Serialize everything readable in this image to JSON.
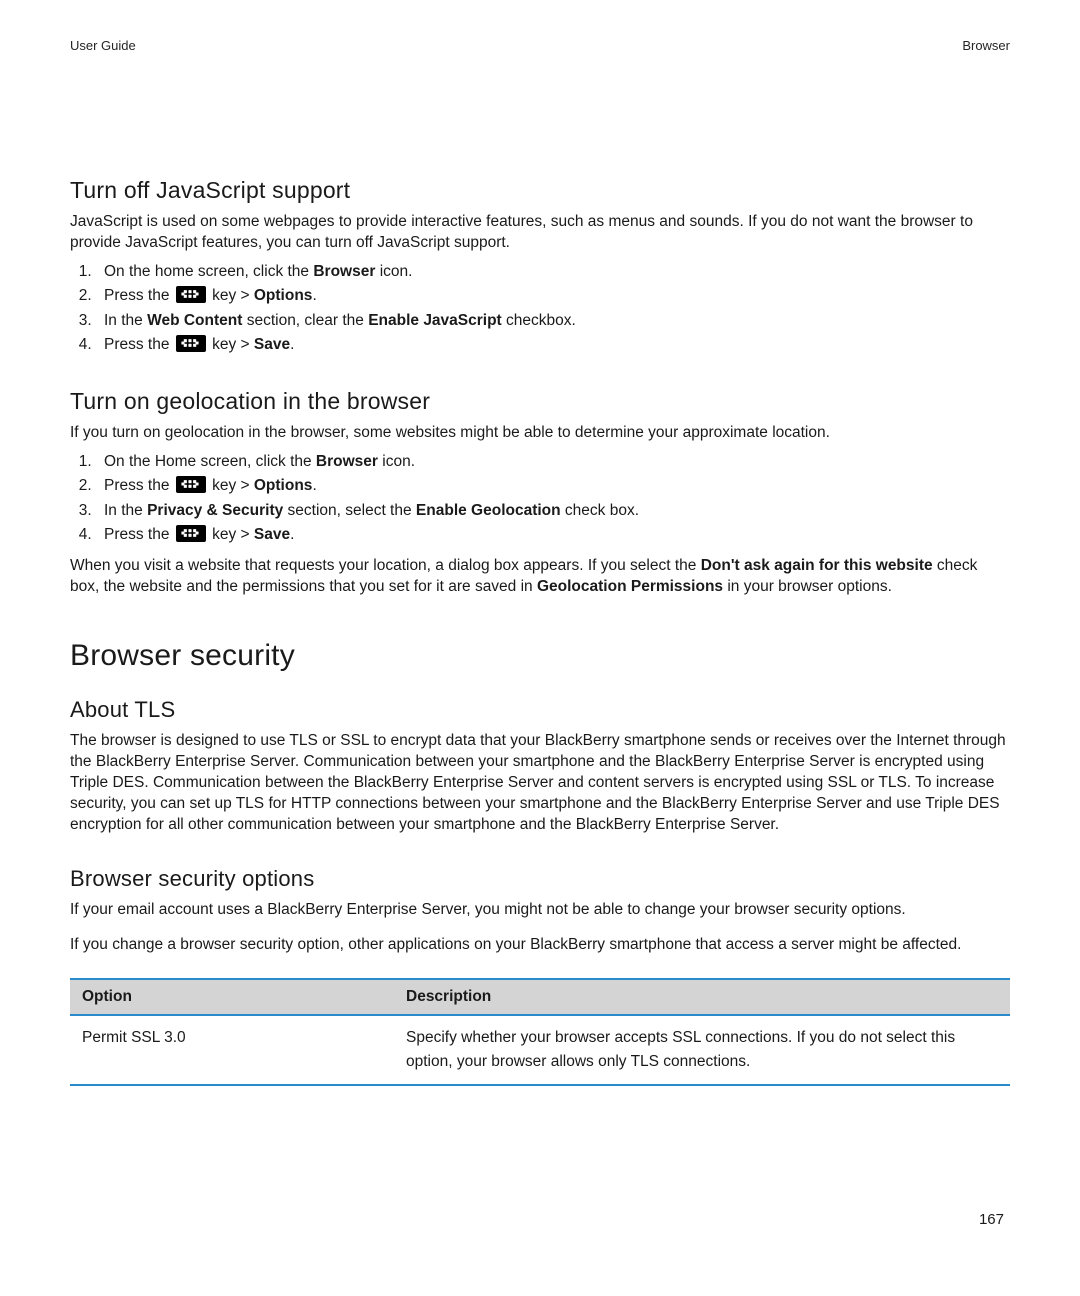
{
  "header": {
    "left": "User Guide",
    "right": "Browser"
  },
  "js": {
    "title": "Turn off JavaScript support",
    "intro": "JavaScript is used on some webpages to provide interactive features, such as menus and sounds. If you do not want the browser to provide JavaScript features, you can turn off JavaScript support.",
    "step1_pre": "On the home screen, click the ",
    "step1_bold": "Browser",
    "step1_post": " icon.",
    "step2_pre": "Press the ",
    "step2_mid": " key > ",
    "step2_bold": "Options",
    "step2_post": ".",
    "step3_pre": "In the ",
    "step3_bold1": "Web Content",
    "step3_mid": " section, clear the ",
    "step3_bold2": "Enable JavaScript",
    "step3_post": " checkbox.",
    "step4_pre": "Press the ",
    "step4_mid": " key > ",
    "step4_bold": "Save",
    "step4_post": "."
  },
  "geo": {
    "title": "Turn on geolocation in the browser",
    "intro": "If you turn on geolocation in the browser, some websites might be able to determine your approximate location.",
    "step1_pre": "On the Home screen, click the ",
    "step1_bold": "Browser",
    "step1_post": " icon.",
    "step2_pre": "Press the ",
    "step2_mid": " key > ",
    "step2_bold": "Options",
    "step2_post": ".",
    "step3_pre": "In the ",
    "step3_bold1": "Privacy & Security",
    "step3_mid": " section, select the ",
    "step3_bold2": "Enable Geolocation",
    "step3_post": " check box.",
    "step4_pre": "Press the ",
    "step4_mid": " key > ",
    "step4_bold": "Save",
    "step4_post": ".",
    "note_pre": "When you visit a website that requests your location, a dialog box appears. If you select the ",
    "note_bold1": "Don't ask again for this website",
    "note_mid": " check box, the website and the permissions that you set for it are saved in ",
    "note_bold2": "Geolocation Permissions",
    "note_post": " in your browser options."
  },
  "security": {
    "title": "Browser security"
  },
  "tls": {
    "title": "About TLS",
    "body": "The browser is designed to use TLS or SSL to encrypt data that your BlackBerry smartphone sends or receives over the Internet through the BlackBerry Enterprise Server. Communication between your smartphone and the BlackBerry Enterprise Server is encrypted using Triple DES. Communication between the BlackBerry Enterprise Server and content servers is encrypted using SSL or TLS. To increase security, you can set up TLS for HTTP connections between your smartphone and the BlackBerry Enterprise Server and use Triple DES encryption for all other communication between your smartphone and the BlackBerry Enterprise Server."
  },
  "bso": {
    "title": "Browser security options",
    "p1": "If your email account uses a BlackBerry Enterprise Server, you might not be able to change your browser security options.",
    "p2": "If you change a browser security option, other applications on your BlackBerry smartphone that access a server might be affected.",
    "table": {
      "head_option": "Option",
      "head_desc": "Description",
      "rows": [
        {
          "option": "Permit SSL 3.0",
          "desc": "Specify whether your browser accepts SSL connections. If you do not select this option, your browser allows only TLS connections."
        }
      ]
    }
  },
  "page_number": "167"
}
